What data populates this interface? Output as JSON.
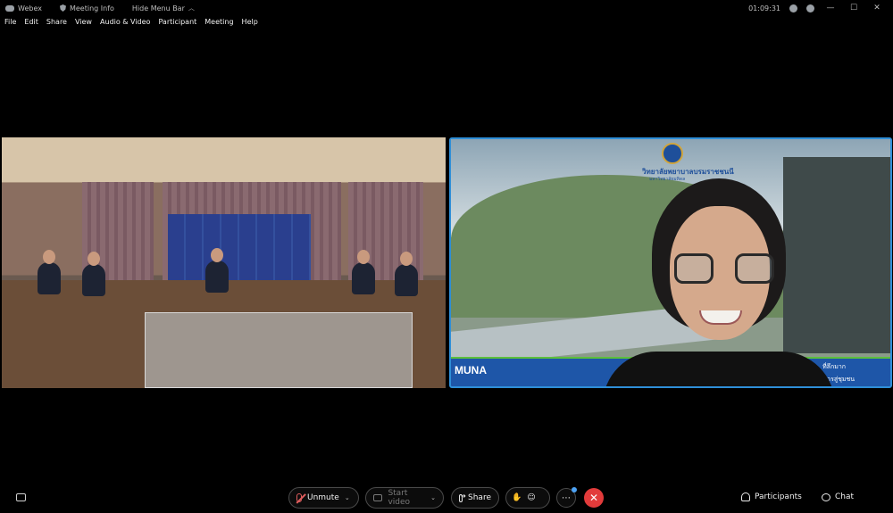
{
  "titlebar": {
    "app_name": "Webex",
    "meeting_info": "Meeting Info",
    "hide_menu_bar": "Hide Menu Bar",
    "clock": "01:09:31",
    "minimize": "—",
    "maximize": "☐",
    "close": "✕"
  },
  "menu": [
    "File",
    "Edit",
    "Share",
    "View",
    "Audio & Video",
    "Participant",
    "Meeting",
    "Help"
  ],
  "videos": {
    "right_tile": {
      "name": "MUNA",
      "logo_text": "วิทยาลัยพยาบาลบรมราชชนนี",
      "logo_sub": "มหาวิทยาลัยมหิดล",
      "banner_line1": "ที่ลึกมาก",
      "banner_line2": "บูรณาการสู่ชุมชน"
    }
  },
  "controls": {
    "unmute": "Unmute",
    "start_video": "Start video",
    "share": "Share",
    "more": "⋯",
    "end": "✕",
    "participants": "Participants",
    "chat": "Chat"
  },
  "colors": {
    "active_speaker_border": "#2f8fd8",
    "end_button": "#e23b3b",
    "muted_mic": "#e05d5d"
  }
}
